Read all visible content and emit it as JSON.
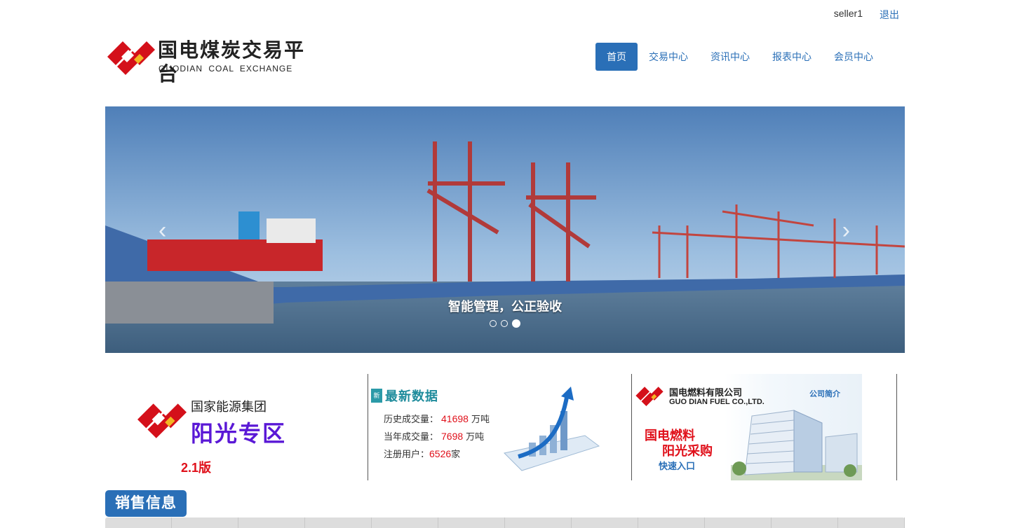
{
  "user": {
    "name": "seller1",
    "logout_label": "退出"
  },
  "logo": {
    "cn": "国电煤炭交易平台",
    "en": "GUODIAN COAL EXCHANGE"
  },
  "nav": {
    "items": [
      "首页",
      "交易中心",
      "资讯中心",
      "报表中心",
      "会员中心"
    ],
    "active": "首页"
  },
  "carousel": {
    "caption": "智能管理，公正验收",
    "slide_count": 3,
    "active_slide": 3,
    "prev_icon": "chevron-left-icon",
    "next_icon": "chevron-right-icon"
  },
  "panel_sunshine": {
    "org": "国家能源集团",
    "zone": "阳光专区",
    "version": "2.1版"
  },
  "panel_stats": {
    "badge": "新",
    "title": "最新数据",
    "history_label": "历史成交量：",
    "history_value": "41698",
    "history_unit": "万吨",
    "year_label": "当年成交量：",
    "year_value": "7698",
    "year_unit": "万吨",
    "users_label": "注册用户：",
    "users_value": "6526",
    "users_unit": "家"
  },
  "panel_fuel": {
    "company": "国电燃料有限公司",
    "company_en": "GUO DIAN FUEL CO.,LTD.",
    "intro": "公司简介",
    "line1": "国电燃料",
    "line2": "阳光采购",
    "entry": "快速入口"
  },
  "sales": {
    "title": "销售信息",
    "columns": 11
  },
  "colors": {
    "accent": "#2a6fb7",
    "red": "#e0111b",
    "purple": "#5a18d6",
    "teal": "#1f8c9c"
  }
}
